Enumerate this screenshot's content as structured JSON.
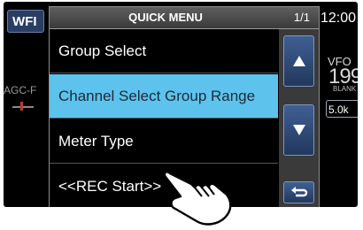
{
  "background": {
    "mode_button": "WFI",
    "agc_label": "AGC-F",
    "clock": "12:00",
    "vfo_label": "VFO",
    "channel_number": "199",
    "channel_state": "BLANK",
    "tuning_step": "5.0k"
  },
  "menu": {
    "title": "QUICK MENU",
    "page_indicator": "1/1",
    "items": [
      {
        "label": "Group Select",
        "selected": false
      },
      {
        "label": "Channel Select Group Range",
        "selected": true
      },
      {
        "label": "Meter Type",
        "selected": false
      },
      {
        "label": "<<REC Start>>",
        "selected": false
      }
    ],
    "selection_color": "#5dc3ec"
  },
  "icons": {
    "scroll_up": "triangle-up-icon",
    "scroll_down": "triangle-down-icon",
    "back": "return-arrow-icon",
    "pointer": "tapping-hand-icon"
  }
}
